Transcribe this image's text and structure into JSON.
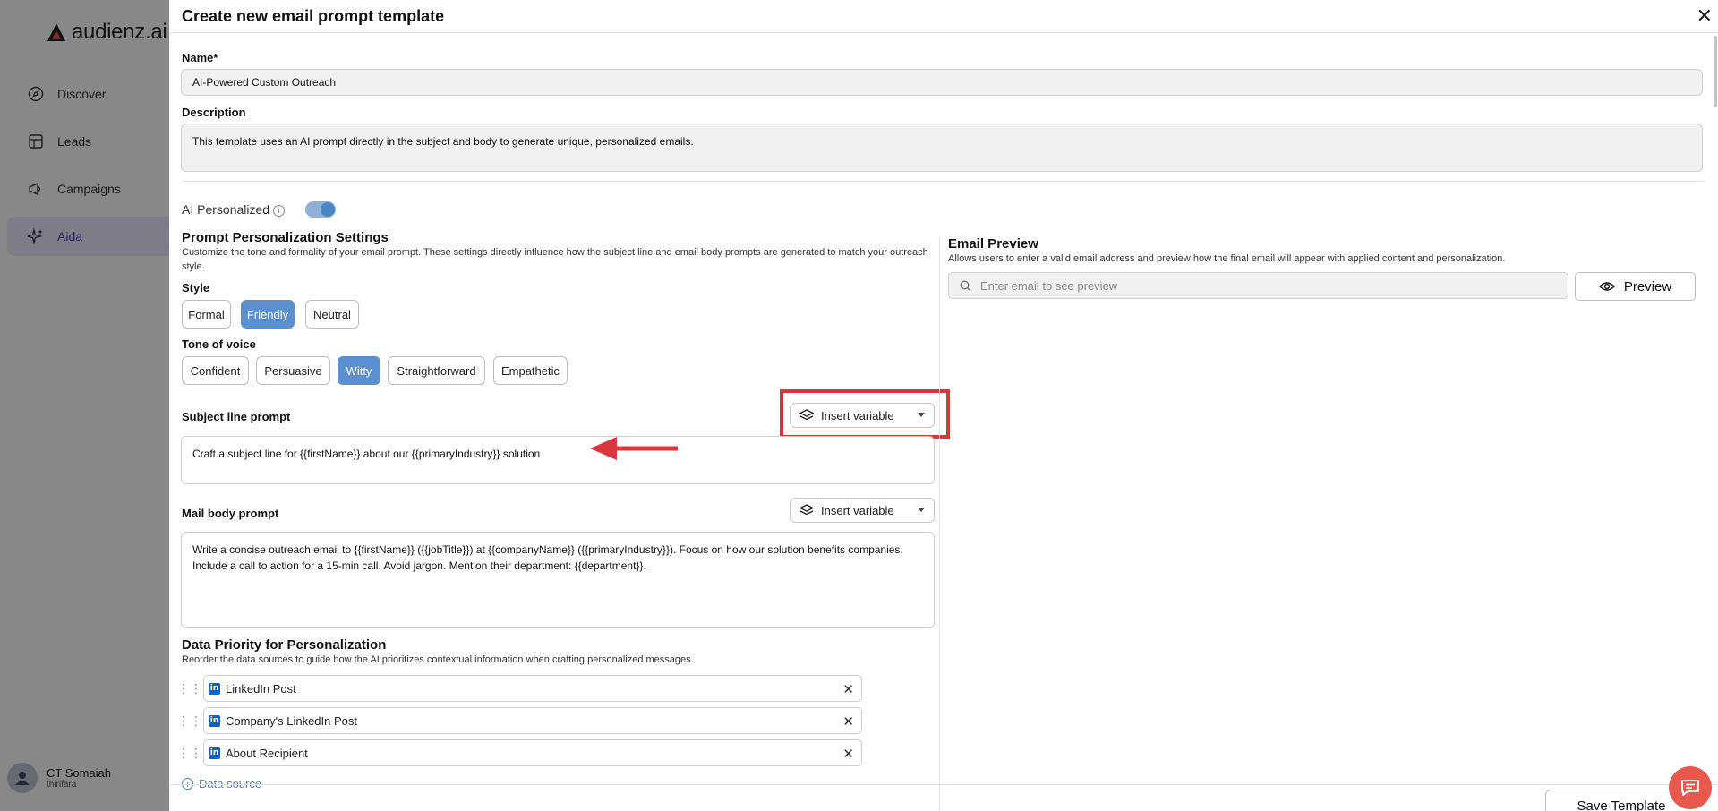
{
  "app": {
    "logo_text": "audienz.ai",
    "nav": [
      {
        "label": "Discover",
        "icon": "compass-icon"
      },
      {
        "label": "Leads",
        "icon": "table-icon"
      },
      {
        "label": "Campaigns",
        "icon": "megaphone-icon"
      },
      {
        "label": "Aida",
        "icon": "sparkles-icon",
        "active": true
      }
    ],
    "user": {
      "name": "CT Somaiah",
      "sub": "thirifara"
    }
  },
  "modal": {
    "title": "Create new email prompt template",
    "close_label": "✕",
    "name_label": "Name*",
    "name_value": "AI-Powered Custom Outreach",
    "description_label": "Description",
    "description_value": "This template uses an AI prompt directly in the subject and body to generate unique, personalized emails.",
    "ai_personalized_label": "AI Personalized",
    "ai_personalized_on": true,
    "settings_title": "Prompt Personalization Settings",
    "settings_desc": "Customize the tone and formality of your email prompt. These settings directly influence how the subject line and email body prompts are generated to match your outreach style.",
    "style_label": "Style",
    "style_options": [
      "Formal",
      "Friendly",
      "Neutral"
    ],
    "style_selected": "Friendly",
    "tone_label": "Tone of voice",
    "tone_options": [
      "Confident",
      "Persuasive",
      "Witty",
      "Straightforward",
      "Empathetic"
    ],
    "tone_selected": "Witty",
    "subject_label": "Subject line prompt",
    "insert_variable_label": "Insert variable",
    "subject_value": "Craft a subject line for {{firstName}} about our {{primaryIndustry}} solution",
    "body_label": "Mail body prompt",
    "body_value": "Write a concise outreach email to {{firstName}} ({{jobTitle}}) at {{companyName}} ({{primaryIndustry}}). Focus on how our solution benefits companies. Include a call to action for a 15-min call. Avoid jargon. Mention their department: {{department}}.",
    "priority_title": "Data Priority for Personalization",
    "priority_desc": "Reorder the data sources to guide how the AI prioritizes contextual information when crafting personalized messages.",
    "priority_items": [
      "LinkedIn Post",
      "Company's LinkedIn Post",
      "About Recipient"
    ],
    "data_source_label": "Data source",
    "preview_title": "Email Preview",
    "preview_desc": "Allows users to enter a valid email address and preview how the final email will appear with applied content and personalization.",
    "preview_placeholder": "Enter email to see preview",
    "preview_button": "Preview",
    "save_button": "Save Template"
  },
  "colors": {
    "accent": "#5b8fcf",
    "highlight": "#d9363e",
    "chat": "#e8584c"
  }
}
